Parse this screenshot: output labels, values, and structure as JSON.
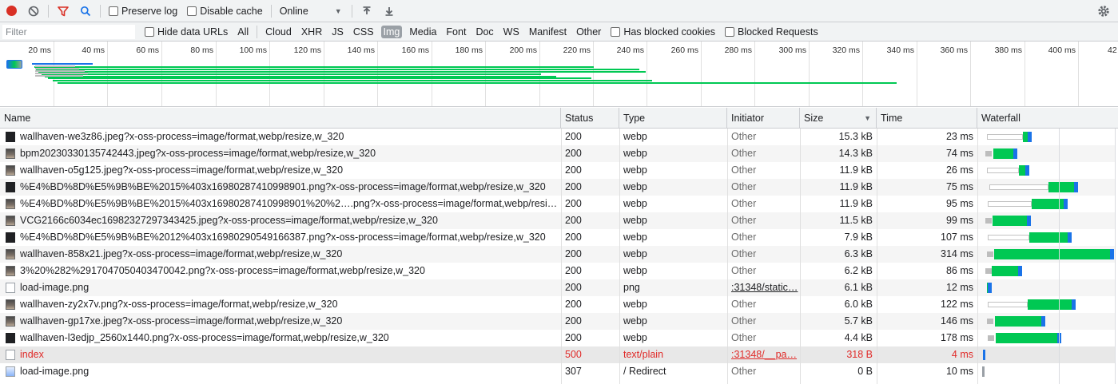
{
  "toolbar": {
    "preserve_log": "Preserve log",
    "disable_cache": "Disable cache",
    "throttle_value": "Online"
  },
  "filterbar": {
    "filter_placeholder": "Filter",
    "hide_data_urls": "Hide data URLs",
    "types": [
      "All",
      "Cloud",
      "XHR",
      "JS",
      "CSS",
      "Img",
      "Media",
      "Font",
      "Doc",
      "WS",
      "Manifest",
      "Other"
    ],
    "active_type": "Img",
    "has_blocked_cookies": "Has blocked cookies",
    "blocked_requests": "Blocked Requests"
  },
  "overview": {
    "ticks": [
      "20 ms",
      "40 ms",
      "60 ms",
      "80 ms",
      "100 ms",
      "120 ms",
      "140 ms",
      "160 ms",
      "180 ms",
      "200 ms",
      "220 ms",
      "240 ms",
      "260 ms",
      "280 ms",
      "300 ms",
      "320 ms",
      "340 ms",
      "360 ms",
      "380 ms",
      "400 ms",
      "42"
    ]
  },
  "columns": {
    "name": "Name",
    "status": "Status",
    "type": "Type",
    "initiator": "Initiator",
    "size": "Size",
    "time": "Time",
    "waterfall": "Waterfall"
  },
  "rows": [
    {
      "name": "wallhaven-we3z86.jpeg?x-oss-process=image/format,webp/resize,w_320",
      "status": "200",
      "type": "webp",
      "initiator": "Other",
      "size": "15.3 kB",
      "time": "23 ms",
      "icon": "image-thumb-icon"
    },
    {
      "name": "bpm20230330135742443.jpeg?x-oss-process=image/format,webp/resize,w_320",
      "status": "200",
      "type": "webp",
      "initiator": "Other",
      "size": "14.3 kB",
      "time": "74 ms",
      "icon": "image-thumb-icon"
    },
    {
      "name": "wallhaven-o5g125.jpeg?x-oss-process=image/format,webp/resize,w_320",
      "status": "200",
      "type": "webp",
      "initiator": "Other",
      "size": "11.9 kB",
      "time": "26 ms",
      "icon": "image-thumb-icon"
    },
    {
      "name": "%E4%BD%8D%E5%9B%BE%2015%403x16980287410998901.png?x-oss-process=image/format,webp/resize,w_320",
      "status": "200",
      "type": "webp",
      "initiator": "Other",
      "size": "11.9 kB",
      "time": "75 ms",
      "icon": "image-thumb-icon"
    },
    {
      "name": "%E4%BD%8D%E5%9B%BE%2015%403x16980287410998901%20%2….png?x-oss-process=image/format,webp/resiz…",
      "status": "200",
      "type": "webp",
      "initiator": "Other",
      "size": "11.9 kB",
      "time": "95 ms",
      "icon": "image-thumb-icon"
    },
    {
      "name": "VCG2166c6034ec16982327297343425.jpeg?x-oss-process=image/format,webp/resize,w_320",
      "status": "200",
      "type": "webp",
      "initiator": "Other",
      "size": "11.5 kB",
      "time": "99 ms",
      "icon": "image-thumb-icon"
    },
    {
      "name": "%E4%BD%8D%E5%9B%BE%2012%403x16980290549166387.png?x-oss-process=image/format,webp/resize,w_320",
      "status": "200",
      "type": "webp",
      "initiator": "Other",
      "size": "7.9 kB",
      "time": "107 ms",
      "icon": "image-thumb-icon"
    },
    {
      "name": "wallhaven-858x21.jpeg?x-oss-process=image/format,webp/resize,w_320",
      "status": "200",
      "type": "webp",
      "initiator": "Other",
      "size": "6.3 kB",
      "time": "314 ms",
      "icon": "image-thumb-icon"
    },
    {
      "name": "3%20%282%2917047050403470042.png?x-oss-process=image/format,webp/resize,w_320",
      "status": "200",
      "type": "webp",
      "initiator": "Other",
      "size": "6.2 kB",
      "time": "86 ms",
      "icon": "image-thumb-icon"
    },
    {
      "name": "load-image.png",
      "status": "200",
      "type": "png",
      "initiator": ":31348/static…",
      "size": "6.1 kB",
      "time": "12 ms",
      "icon": "blank-file-icon"
    },
    {
      "name": "wallhaven-zy2x7v.png?x-oss-process=image/format,webp/resize,w_320",
      "status": "200",
      "type": "webp",
      "initiator": "Other",
      "size": "6.0 kB",
      "time": "122 ms",
      "icon": "image-thumb-icon"
    },
    {
      "name": "wallhaven-gp17xe.jpeg?x-oss-process=image/format,webp/resize,w_320",
      "status": "200",
      "type": "webp",
      "initiator": "Other",
      "size": "5.7 kB",
      "time": "146 ms",
      "icon": "image-thumb-icon"
    },
    {
      "name": "wallhaven-l3edjp_2560x1440.png?x-oss-process=image/format,webp/resize,w_320",
      "status": "200",
      "type": "webp",
      "initiator": "Other",
      "size": "4.4 kB",
      "time": "178 ms",
      "icon": "image-thumb-icon"
    },
    {
      "name": "index",
      "status": "500",
      "type": "text/plain",
      "initiator": ":31348/__pa…",
      "size": "318 B",
      "time": "4 ms",
      "icon": "blank-file-icon",
      "error": true
    },
    {
      "name": "load-image.png",
      "status": "307",
      "type": "/ Redirect",
      "initiator": "Other",
      "size": "0 B",
      "time": "10 ms",
      "icon": "image-file-icon"
    }
  ],
  "colors": {
    "waiting": "#00c853",
    "download": "#1a73e8",
    "error_text": "#e02a28",
    "record": "#d93025"
  }
}
